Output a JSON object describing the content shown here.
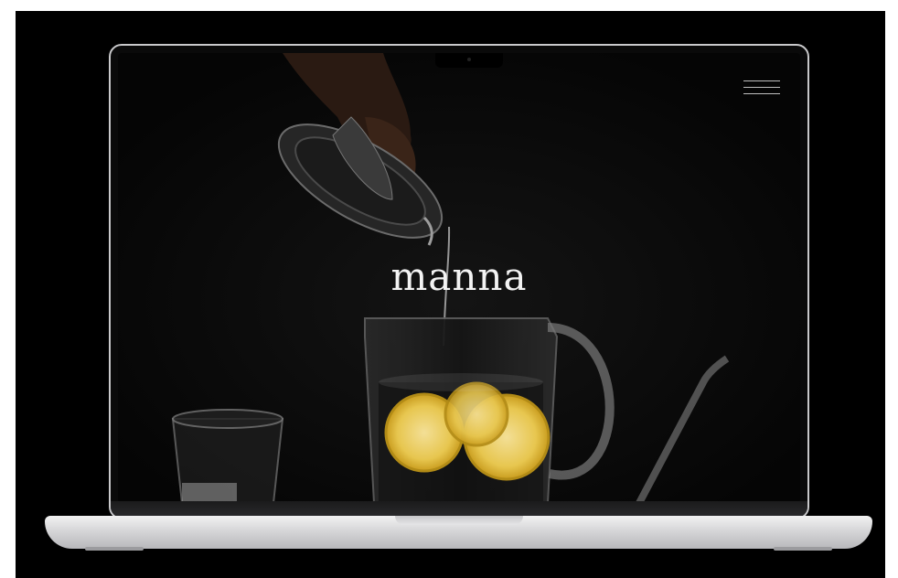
{
  "site": {
    "brand": "manna"
  },
  "header": {
    "menu_icon": "hamburger-menu-icon"
  },
  "hero": {
    "image": "lemon-juicer-pouring-into-glass-pitcher",
    "background_color": "#050505",
    "text_color": "#f3f3f3"
  }
}
